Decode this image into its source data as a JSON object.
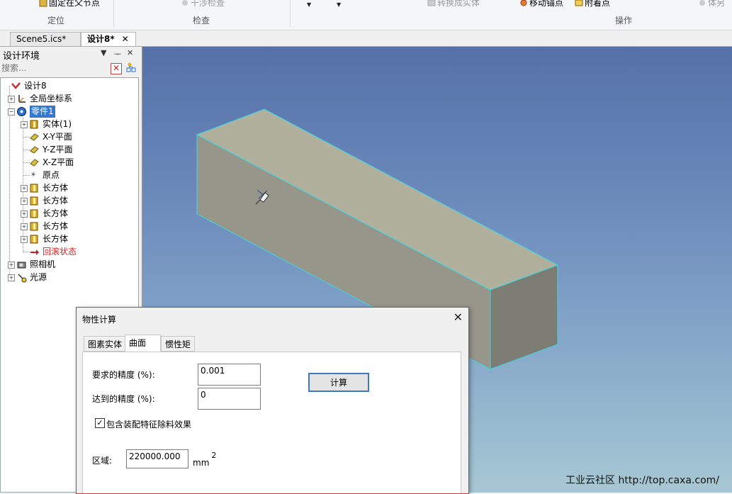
{
  "ribbon": {
    "items": [
      {
        "label": "固定在父节点",
        "disabled": false
      },
      {
        "label": "干涉检查",
        "disabled": true
      },
      {
        "label": "转换成实体",
        "disabled": true
      },
      {
        "label": "移动锚点",
        "disabled": false
      },
      {
        "label": "附着点",
        "disabled": false
      },
      {
        "label": "体另",
        "disabled": true
      }
    ],
    "groups": [
      "定位",
      "检查",
      "操作"
    ]
  },
  "doc_tabs": [
    {
      "label": "Scene5.ics*",
      "active": false
    },
    {
      "label": "设计8*",
      "active": true,
      "close": "✕"
    }
  ],
  "panel": {
    "title": "设计环境",
    "search_placeholder": "搜索...",
    "tree": [
      {
        "label": "设计8",
        "icon": "design-icon",
        "level": 0,
        "expander": ""
      },
      {
        "label": "全局坐标系",
        "icon": "axes-icon",
        "level": 1,
        "expander": "+"
      },
      {
        "label": "零件1",
        "icon": "part-icon",
        "level": 1,
        "expander": "−",
        "selected": true
      },
      {
        "label": "实体(1)",
        "icon": "solid-icon",
        "level": 2,
        "expander": "+"
      },
      {
        "label": "X-Y平面",
        "icon": "plane-icon",
        "level": 2,
        "expander": ""
      },
      {
        "label": "Y-Z平面",
        "icon": "plane-icon",
        "level": 2,
        "expander": ""
      },
      {
        "label": "X-Z平面",
        "icon": "plane-icon",
        "level": 2,
        "expander": ""
      },
      {
        "label": "原点",
        "icon": "origin-icon",
        "level": 2,
        "expander": ""
      },
      {
        "label": "长方体",
        "icon": "cuboid-icon",
        "level": 2,
        "expander": "+"
      },
      {
        "label": "长方体",
        "icon": "cuboid-icon",
        "level": 2,
        "expander": "+"
      },
      {
        "label": "长方体",
        "icon": "cuboid-icon",
        "level": 2,
        "expander": "+"
      },
      {
        "label": "长方体",
        "icon": "cuboid-icon",
        "level": 2,
        "expander": "+"
      },
      {
        "label": "长方体",
        "icon": "cuboid-icon",
        "level": 2,
        "expander": "+"
      },
      {
        "label": "回滚状态",
        "icon": "rollback-arrow-icon",
        "level": 2,
        "expander": "",
        "rollback": true
      },
      {
        "label": "照相机",
        "icon": "camera-icon",
        "level": 1,
        "expander": "+"
      },
      {
        "label": "光源",
        "icon": "light-icon",
        "level": 1,
        "expander": "+"
      }
    ]
  },
  "dialog": {
    "title": "物性计算",
    "close": "✕",
    "tabs": [
      {
        "label": "图素实体",
        "active": false
      },
      {
        "label": "曲面",
        "active": true
      },
      {
        "label": "惯性矩",
        "active": false
      }
    ],
    "required_precision_label": "要求的精度 (%):",
    "required_precision_value": "0.001",
    "achieved_precision_label": "达到的精度 (%):",
    "achieved_precision_value": "0",
    "calculate_button": "计算",
    "include_assembly_label": "包含装配特征除料效果",
    "include_assembly_checked": true,
    "area_label": "区域:",
    "area_value": "220000.000",
    "area_unit": "mm",
    "area_unit_exp": "2"
  },
  "viewport": {
    "watermark": "工业云社区 http://top.caxa.com/",
    "box_top_color": "#b1b09c",
    "box_front_color": "#97968a",
    "box_side_color": "#7e7d73",
    "edge_color": "#3fd7e6"
  }
}
